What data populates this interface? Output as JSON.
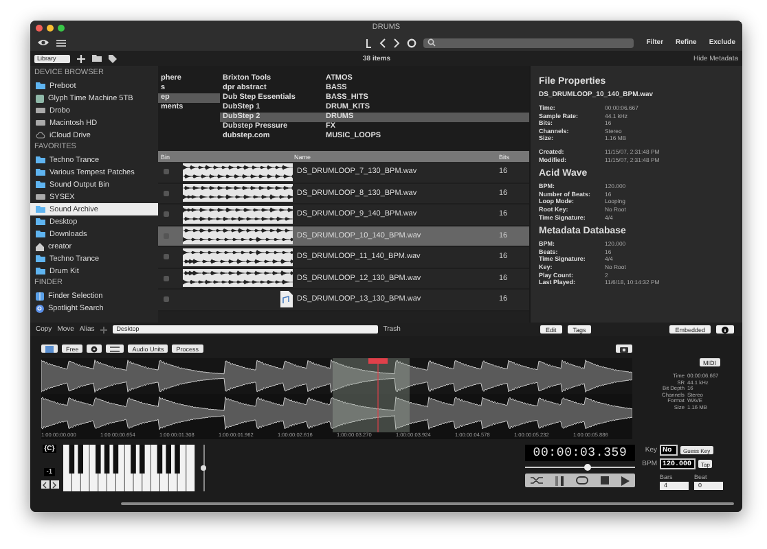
{
  "window": {
    "title": "DRUMS"
  },
  "toolbar": {
    "buttons": [
      "Filter",
      "Refine",
      "Exclude"
    ]
  },
  "browser_bar": {
    "library": "Library",
    "count": "38 items",
    "hide_metadata": "Hide Metadata"
  },
  "sidebar": {
    "sections": [
      {
        "title": "DEVICE BROWSER",
        "items": [
          {
            "label": "Preboot",
            "kind": "folder",
            "selected": false
          },
          {
            "label": "Glyph Time Machine 5TB",
            "kind": "drive",
            "selected": false
          },
          {
            "label": "Drobo",
            "kind": "disk",
            "selected": false
          },
          {
            "label": "Macintosh HD",
            "kind": "disk",
            "selected": false
          },
          {
            "label": "iCloud Drive",
            "kind": "cloud",
            "selected": false
          }
        ]
      },
      {
        "title": "FAVORITES",
        "items": [
          {
            "label": "Techno Trance",
            "kind": "folder",
            "selected": false
          },
          {
            "label": "Various Tempest Patches",
            "kind": "folder",
            "selected": false
          },
          {
            "label": "Sound Output Bin",
            "kind": "folder",
            "selected": false
          },
          {
            "label": "SYSEX",
            "kind": "disk",
            "selected": false
          },
          {
            "label": "Sound Archive",
            "kind": "folder",
            "selected": true
          },
          {
            "label": "Desktop",
            "kind": "folder",
            "selected": false
          },
          {
            "label": "Downloads",
            "kind": "folder",
            "selected": false
          },
          {
            "label": "creator",
            "kind": "home",
            "selected": false
          },
          {
            "label": "Techno Trance",
            "kind": "folder",
            "selected": false
          },
          {
            "label": "Drum Kit",
            "kind": "folder",
            "selected": false
          }
        ]
      },
      {
        "title": "FINDER",
        "items": [
          {
            "label": "Finder Selection",
            "kind": "finder",
            "selected": false
          },
          {
            "label": "Spotlight Search",
            "kind": "spotlight",
            "selected": false
          }
        ]
      }
    ]
  },
  "categories": {
    "columns": [
      [
        {
          "label": "phere",
          "selected": false
        },
        {
          "label": "s",
          "selected": false
        },
        {
          "label": "ep",
          "selected": true
        },
        {
          "label": "ments",
          "selected": false
        }
      ],
      [
        {
          "label": "Brixton Tools",
          "selected": false
        },
        {
          "label": "dpr abstract",
          "selected": false
        },
        {
          "label": "Dub Step Essentials",
          "selected": false
        },
        {
          "label": "DubStep 1",
          "selected": false
        },
        {
          "label": "DubStep 2",
          "selected": true
        },
        {
          "label": "Dubstep Pressure",
          "selected": false
        },
        {
          "label": "dubstep.com",
          "selected": false
        }
      ],
      [
        {
          "label": "ATMOS",
          "selected": false
        },
        {
          "label": "BASS",
          "selected": false
        },
        {
          "label": "BASS_HITS",
          "selected": false
        },
        {
          "label": "DRUM_KITS",
          "selected": false
        },
        {
          "label": "DRUMS",
          "selected": true
        },
        {
          "label": "FX",
          "selected": false
        },
        {
          "label": "MUSIC_LOOPS",
          "selected": false
        }
      ]
    ]
  },
  "table": {
    "columns": [
      "Bin",
      "Name",
      "Bits"
    ],
    "rows": [
      {
        "name": "DS_DRUMLOOP_7_130_BPM.wav",
        "bits": "16",
        "kind": "waveform",
        "checked": false,
        "selected": false
      },
      {
        "name": "DS_DRUMLOOP_8_130_BPM.wav",
        "bits": "16",
        "kind": "waveform",
        "checked": false,
        "selected": false
      },
      {
        "name": "DS_DRUMLOOP_9_140_BPM.wav",
        "bits": "16",
        "kind": "waveform",
        "checked": false,
        "selected": false
      },
      {
        "name": "DS_DRUMLOOP_10_140_BPM.wav",
        "bits": "16",
        "kind": "waveform",
        "checked": false,
        "selected": true
      },
      {
        "name": "DS_DRUMLOOP_11_140_BPM.wav",
        "bits": "16",
        "kind": "waveform",
        "checked": false,
        "selected": false
      },
      {
        "name": "DS_DRUMLOOP_12_130_BPM.wav",
        "bits": "16",
        "kind": "waveform",
        "checked": false,
        "selected": false
      },
      {
        "name": "DS_DRUMLOOP_13_130_BPM.wav",
        "bits": "16",
        "kind": "file",
        "checked": false,
        "selected": false
      }
    ]
  },
  "metadata": {
    "sections": [
      {
        "title": "File Properties",
        "file": "DS_DRUMLOOP_10_140_BPM.wav",
        "groups": [
          [
            {
              "label": "Time:",
              "value": "00:00:06.667"
            },
            {
              "label": "Sample Rate:",
              "value": "44.1 kHz"
            },
            {
              "label": "Bits:",
              "value": "16"
            },
            {
              "label": "Channels:",
              "value": "Stereo"
            },
            {
              "label": "Size:",
              "value": "1.16 MB"
            }
          ],
          [
            {
              "label": "Created:",
              "value": "11/15/07, 2:31:48 PM"
            },
            {
              "label": "Modified:",
              "value": "11/15/07, 2:31:48 PM"
            }
          ]
        ]
      },
      {
        "title": "Acid Wave",
        "groups": [
          [
            {
              "label": "BPM:",
              "value": "120.000"
            },
            {
              "label": "Number of Beats:",
              "value": "16"
            },
            {
              "label": "Loop Mode:",
              "value": "Looping"
            },
            {
              "label": "Root Key:",
              "value": "No Root"
            },
            {
              "label": "Time Signature:",
              "value": "4/4"
            }
          ]
        ]
      },
      {
        "title": "Metadata Database",
        "groups": [
          [
            {
              "label": "BPM:",
              "value": "120.000"
            },
            {
              "label": "Beats:",
              "value": "16"
            },
            {
              "label": "Time Signature:",
              "value": "4/4"
            },
            {
              "label": "Key:",
              "value": "No Root"
            },
            {
              "label": "Play Count:",
              "value": "2"
            },
            {
              "label": "Last Played:",
              "value": "11/6/18, 10:14:32 PM"
            }
          ]
        ]
      }
    ]
  },
  "actions": {
    "file_actions": [
      "Copy",
      "Move",
      "Alias"
    ],
    "destination": "Desktop",
    "trash": "Trash",
    "edit": "Edit",
    "tags": "Tags",
    "embedded": "Embedded"
  },
  "editor": {
    "free": "Free",
    "audio_units": "Audio Units",
    "process": "Process",
    "midi": "MIDI",
    "timeline": [
      "1:00:00:00.000",
      "1:00:00:00.654",
      "1:00:00:01.308",
      "1:00:00:01.962",
      "1:00:00:02.616",
      "1:00:00:03.270",
      "1:00:00:03.924",
      "1:00:00:04.578",
      "1:00:00:05.232",
      "1:00:00:05.886"
    ],
    "info": [
      {
        "label": "Time",
        "value": "00:00:06.667"
      },
      {
        "label": "SR",
        "value": "44.1 kHz"
      },
      {
        "label": "Bit Depth",
        "value": "16"
      },
      {
        "label": "Channels",
        "value": "Stereo"
      },
      {
        "label": "Format",
        "value": "WAVE"
      },
      {
        "label": "Size",
        "value": "1.16 MB"
      }
    ],
    "octave_label": "{C}",
    "octave": "-1",
    "volume": {
      "level": 0.5
    },
    "time": "00:00:03.359",
    "position": {
      "level": 0.58
    },
    "key": {
      "label": "Key",
      "value": "No",
      "button": "Guess Key"
    },
    "bpm": {
      "label": "BPM",
      "value": "120.000",
      "button": "Tap"
    },
    "bars": {
      "label": "Bars",
      "value": "4"
    },
    "beat": {
      "label": "Beat",
      "value": "0"
    }
  }
}
